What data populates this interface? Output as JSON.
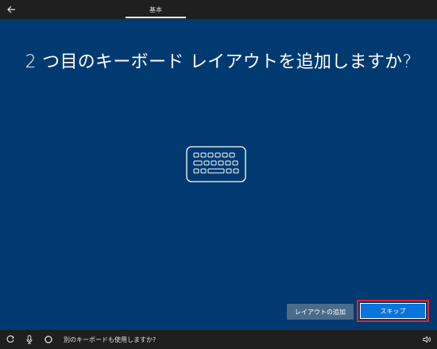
{
  "header": {
    "tab_label": "基本"
  },
  "main": {
    "title": "2 つ目のキーボード レイアウトを追加しますか?"
  },
  "buttons": {
    "add_layout_label": "レイアウトの追加",
    "skip_label": "スキップ"
  },
  "taskbar": {
    "status_text": "別のキーボードも使用しますか?",
    "icons": [
      "ease-of-access-icon",
      "microphone-icon",
      "cortana-icon",
      "volume-icon"
    ]
  },
  "colors": {
    "background": "#003a70",
    "bar": "#1f1f1f",
    "skip_button": "#0a74da",
    "add_button": "#4a6c8a",
    "highlight": "#e0242a"
  }
}
